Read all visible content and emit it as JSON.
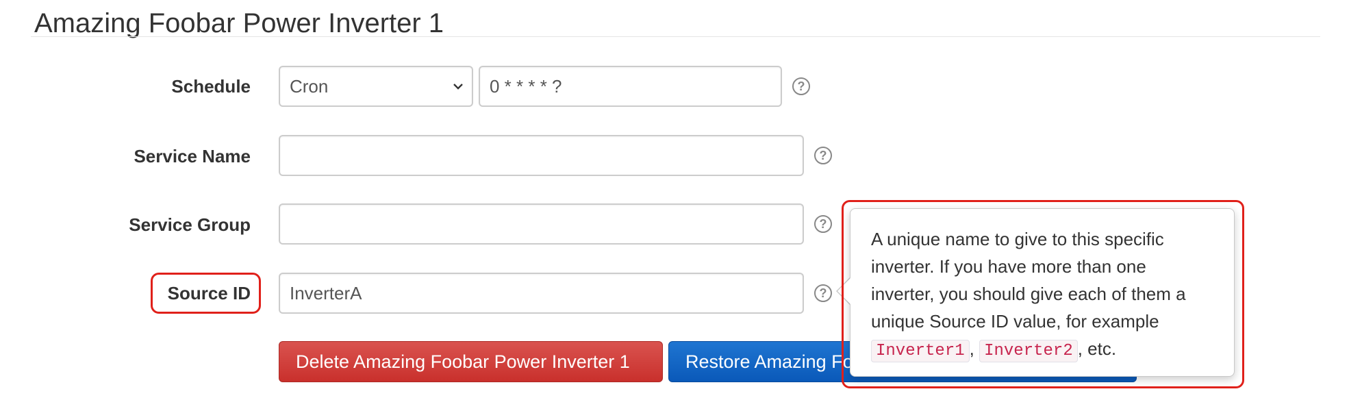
{
  "page": {
    "title": "Amazing Foobar Power Inverter 1"
  },
  "form": {
    "schedule": {
      "label": "Schedule",
      "type_value": "Cron",
      "expression_value": "0 * * * * ?"
    },
    "service_name": {
      "label": "Service Name",
      "value": ""
    },
    "service_group": {
      "label": "Service Group",
      "value": ""
    },
    "source_id": {
      "label": "Source ID",
      "value": "InverterA"
    },
    "help_glyph": "?"
  },
  "buttons": {
    "delete_label": "Delete Amazing Foobar Power Inverter 1",
    "restore_label": "Restore Amazing Foobar Power Inverter 1"
  },
  "popover": {
    "text_before": "A unique name to give to this specific inverter. If you have more than one inverter, you should give each of them a unique Source ID value, for example",
    "code1": "Inverter1",
    "sep": ",",
    "code2": "Inverter2",
    "text_after": ", etc."
  },
  "colors": {
    "annotation": "#e0201a",
    "danger": "#d9534f",
    "primary": "#0a62c7"
  }
}
